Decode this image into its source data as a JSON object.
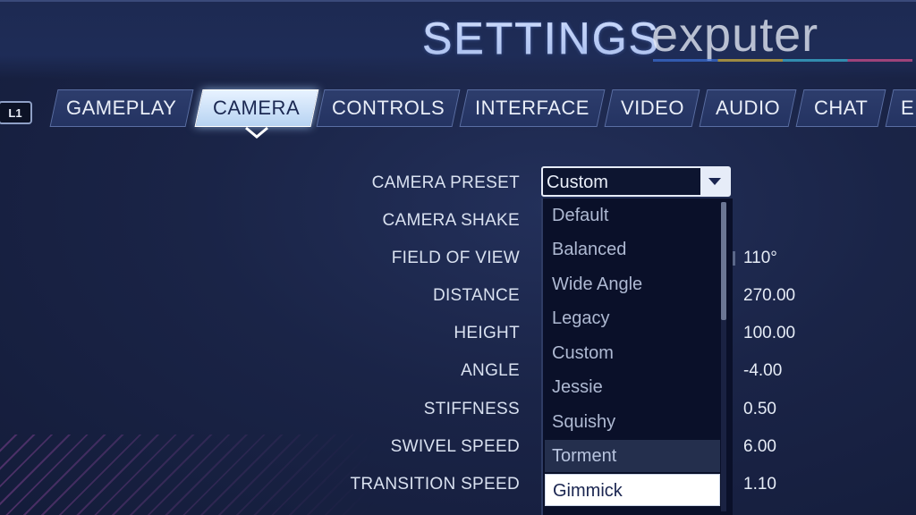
{
  "header": {
    "title": "SETTINGS",
    "watermark": "exputer",
    "bumper_left": "L1"
  },
  "tabs": [
    {
      "label": "GAMEPLAY",
      "active": false
    },
    {
      "label": "CAMERA",
      "active": true
    },
    {
      "label": "CONTROLS",
      "active": false
    },
    {
      "label": "INTERFACE",
      "active": false
    },
    {
      "label": "VIDEO",
      "active": false
    },
    {
      "label": "AUDIO",
      "active": false
    },
    {
      "label": "CHAT",
      "active": false
    },
    {
      "label": "E",
      "active": false
    }
  ],
  "camera_settings": {
    "preset": {
      "label": "CAMERA PRESET",
      "value": "Custom"
    },
    "rows": [
      {
        "label": "CAMERA SHAKE",
        "value": ""
      },
      {
        "label": "FIELD OF VIEW",
        "value": "110°"
      },
      {
        "label": "DISTANCE",
        "value": "270.00"
      },
      {
        "label": "HEIGHT",
        "value": "100.00"
      },
      {
        "label": "ANGLE",
        "value": "-4.00"
      },
      {
        "label": "STIFFNESS",
        "value": "0.50"
      },
      {
        "label": "SWIVEL SPEED",
        "value": "6.00"
      },
      {
        "label": "TRANSITION SPEED",
        "value": "1.10"
      }
    ]
  },
  "dropdown": {
    "options": [
      "Default",
      "Balanced",
      "Wide Angle",
      "Legacy",
      "Custom",
      "Jessie",
      "Squishy",
      "Torment",
      "Gimmick"
    ],
    "hovered": "Torment",
    "selected": "Gimmick"
  },
  "icons": {
    "dropdown_arrow": "chevron-down-icon",
    "tab_pointer": "caret-down-icon"
  },
  "colors": {
    "background": "#1a2447",
    "active_tab": "#dbe9fb",
    "dropdown_bg": "#0a1029",
    "selected_option": "#ffffff"
  }
}
